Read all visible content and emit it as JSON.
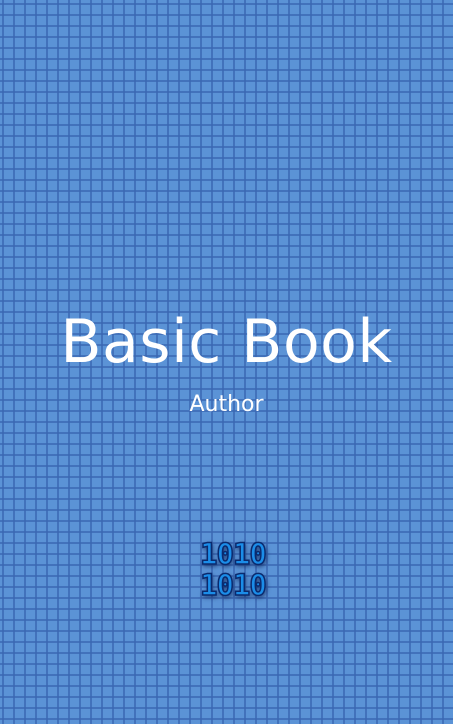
{
  "cover": {
    "title": "Basic Book",
    "author": "Author",
    "logo": {
      "icon": "binary-code-icon",
      "rows": [
        "1010",
        "1010"
      ],
      "color": "#1b8de8"
    },
    "background_color": "#5b93d6",
    "grid_color": "#3a67b2"
  }
}
